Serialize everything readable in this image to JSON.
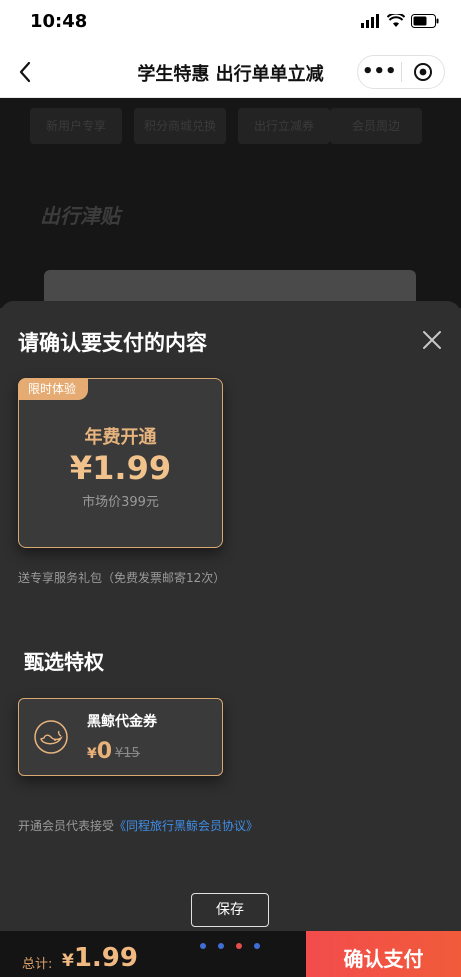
{
  "status_bar": {
    "time": "10:48"
  },
  "nav": {
    "title": "学生特惠 出行单单立减",
    "more_label": "•••"
  },
  "background_page": {
    "tags": [
      "新用户专享",
      "积分商城兑换",
      "出行立减券",
      "会员周边"
    ],
    "heading": "出行津贴"
  },
  "sheet": {
    "title": "请确认要支付的内容",
    "plan": {
      "tag": "限时体验",
      "name": "年费开通",
      "price": "¥1.99",
      "market_price": "市场价399元"
    },
    "gift_note": "送专享服务礼包（免费发票邮寄12次）",
    "privilege_section_title": "甄选特权",
    "voucher": {
      "name": "黑鲸代金券",
      "price_symbol": "¥",
      "price": "0",
      "original_price": "¥15"
    },
    "agreement": {
      "prefix": "开通会员代表接受",
      "link": "《同程旅行黑鲸会员协议》"
    },
    "save_label": "保存"
  },
  "bottom_bar": {
    "total_label": "总计:",
    "total_symbol": "¥",
    "total_value": "1.99",
    "confirm_label": "确认支付"
  },
  "colors": {
    "accent_gold": "#e8b47e",
    "confirm_red": "#f24c4c",
    "link_blue": "#3f8ee8"
  }
}
